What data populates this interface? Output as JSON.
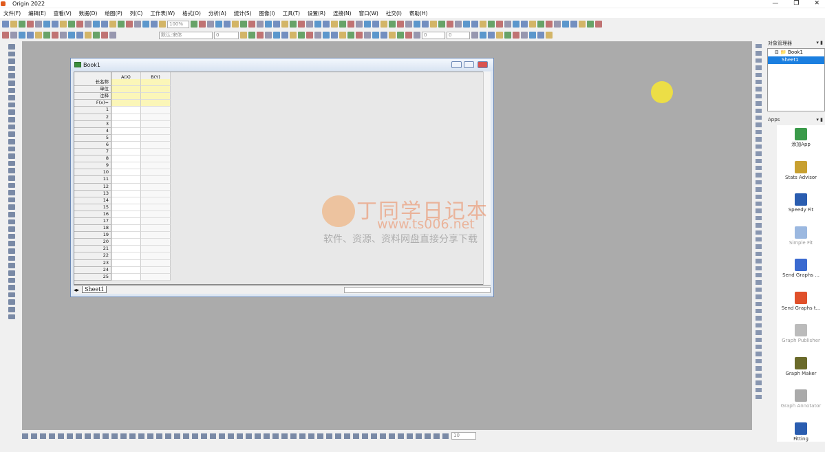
{
  "app": {
    "title": "Origin 2022"
  },
  "menu": [
    "文件(F)",
    "编辑(E)",
    "查看(V)",
    "数据(D)",
    "绘图(P)",
    "列(C)",
    "工作表(W)",
    "格式(O)",
    "分析(A)",
    "统计(S)",
    "图像(I)",
    "工具(T)",
    "设置(R)",
    "连接(N)",
    "窗口(W)",
    "社交(I)",
    "帮助(H)"
  ],
  "toolbar": {
    "zoom": "100%",
    "font": "默认:宋体",
    "font_size": "0",
    "size2": "0",
    "size3": "0",
    "bottom_size": "10"
  },
  "book": {
    "title": "Book1",
    "columns": [
      "A(X)",
      "B(Y)"
    ],
    "label_rows": [
      "长名称",
      "单位",
      "注释",
      "F(x)="
    ],
    "rows": [
      "1",
      "2",
      "3",
      "4",
      "5",
      "6",
      "7",
      "8",
      "9",
      "10",
      "11",
      "12",
      "13",
      "14",
      "15",
      "16",
      "17",
      "18",
      "19",
      "20",
      "21",
      "22",
      "23",
      "24",
      "25"
    ],
    "sheet_tab": "Sheet1"
  },
  "object_manager": {
    "title": "对象管理器",
    "book": "Book1",
    "sheet": "Sheet1"
  },
  "apps": {
    "title": "Apps",
    "items": [
      {
        "label": "添加App",
        "color": "#3a9a4a"
      },
      {
        "label": "Stats Advisor",
        "color": "#c8a030"
      },
      {
        "label": "Speedy Fit",
        "color": "#2a5db0"
      },
      {
        "label": "Simple Fit",
        "color": "#9bb8e0"
      },
      {
        "label": "Send Graphs ...",
        "color": "#3a6ad0"
      },
      {
        "label": "Send Graphs t...",
        "color": "#e0502a"
      },
      {
        "label": "Graph Publisher",
        "color": "#bbbbbb"
      },
      {
        "label": "Graph Maker",
        "color": "#6a6a2a"
      },
      {
        "label": "Graph Annotator",
        "color": "#aaaaaa"
      },
      {
        "label": "Fitting",
        "color": "#2a5db0"
      }
    ]
  },
  "watermark": {
    "title": "丁同学日记本",
    "url": "www.ts006.net",
    "subtitle": "软件、资源、资料网盘直接分享下载"
  }
}
